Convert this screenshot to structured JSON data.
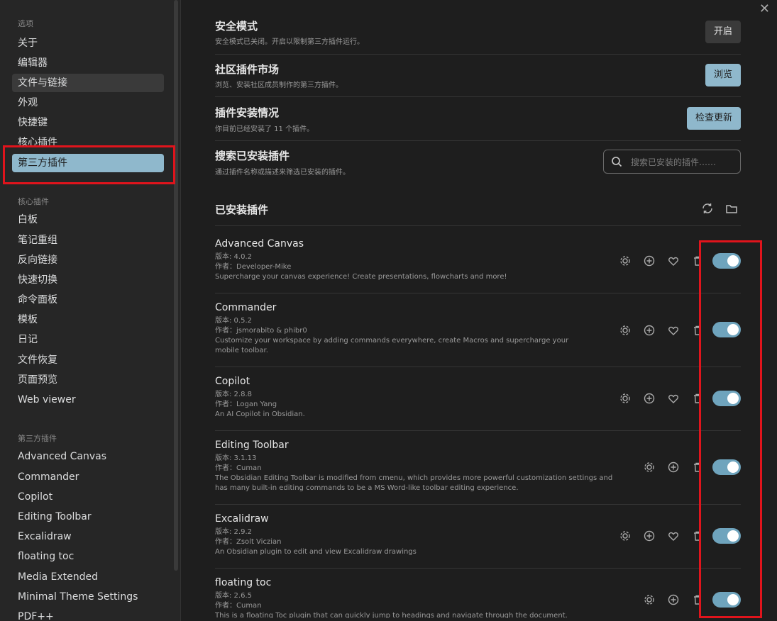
{
  "sidebar": {
    "options_header": "选项",
    "options": [
      "关于",
      "编辑器",
      "文件与链接",
      "外观",
      "快捷键",
      "核心插件",
      "第三方插件"
    ],
    "core_header": "核心插件",
    "core": [
      "白板",
      "笔记重组",
      "反向链接",
      "快速切换",
      "命令面板",
      "模板",
      "日记",
      "文件恢复",
      "页面预览",
      "Web viewer"
    ],
    "third_header": "第三方插件",
    "third": [
      "Advanced Canvas",
      "Commander",
      "Copilot",
      "Editing Toolbar",
      "Excalidraw",
      "floating toc",
      "Media Extended",
      "Minimal Theme Settings",
      "PDF++"
    ]
  },
  "settings": {
    "safe_mode": {
      "title": "安全模式",
      "desc": "安全模式已关闭。开启以限制第三方插件运行。",
      "button": "开启"
    },
    "market": {
      "title": "社区插件市场",
      "desc": "浏览、安装社区成员制作的第三方插件。",
      "button": "浏览"
    },
    "install": {
      "title": "插件安装情况",
      "desc": "你目前已经安装了 11 个插件。",
      "button": "检查更新"
    },
    "search": {
      "title": "搜索已安装插件",
      "desc": "通过插件名称或描述来筛选已安装的插件。",
      "placeholder": "搜索已安装的插件……"
    }
  },
  "installed_header": "已安装插件",
  "plugins": [
    {
      "name": "Advanced Canvas",
      "version": "版本: 4.0.2",
      "author": "作者：Developer-Mike",
      "desc": "Supercharge your canvas experience! Create presentations, flowcharts and more!",
      "enabled": true
    },
    {
      "name": "Commander",
      "version": "版本: 0.5.2",
      "author": "作者：jsmorabito & phibr0",
      "desc": "Customize your workspace by adding commands everywhere, create Macros and supercharge your mobile toolbar.",
      "enabled": true
    },
    {
      "name": "Copilot",
      "version": "版本: 2.8.8",
      "author": "作者：Logan Yang",
      "desc": "An AI Copilot in Obsidian.",
      "enabled": true
    },
    {
      "name": "Editing Toolbar",
      "version": "版本: 3.1.13",
      "author": "作者：Cuman",
      "desc": "The Obsidian Editing Toolbar is modified from cmenu, which provides more powerful customization settings and has many built-in editing commands to be a MS Word-like toolbar editing experience.",
      "enabled": true
    },
    {
      "name": "Excalidraw",
      "version": "版本: 2.9.2",
      "author": "作者：Zsolt Viczian",
      "desc": "An Obsidian plugin to edit and view Excalidraw drawings",
      "enabled": true
    },
    {
      "name": "floating toc",
      "version": "版本: 2.6.5",
      "author": "作者：Cuman",
      "desc": "This is a floating Toc plugin that can quickly jump to headings and navigate through the document.",
      "enabled": true
    }
  ],
  "colors": {
    "accent": "#8fb8cc",
    "toggle": "#6fa4bd",
    "highlight": "#e0141c"
  }
}
